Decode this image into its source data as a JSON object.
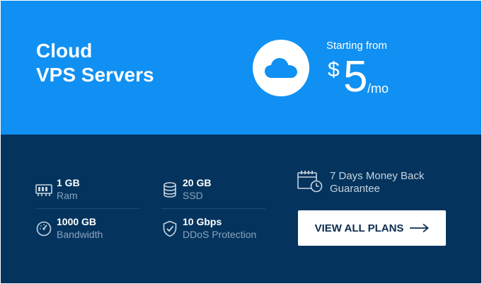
{
  "hero": {
    "title_line1": "Cloud",
    "title_line2": "VPS Servers",
    "starting_label": "Starting from",
    "currency": "$",
    "amount": "5",
    "period": "/mo",
    "icon": "cloud-icon"
  },
  "features": [
    {
      "value": "1 GB",
      "label": "Ram",
      "icon": "ram-chip-icon"
    },
    {
      "value": "20 GB",
      "label": "SSD",
      "icon": "database-icon"
    },
    {
      "value": "1000 GB",
      "label": "Bandwidth",
      "icon": "speedometer-icon"
    },
    {
      "value": "10 Gbps",
      "label": "DDoS Protection",
      "icon": "shield-check-icon"
    }
  ],
  "guarantee": {
    "line1": "7 Days Money Back",
    "line2": "Guarantee",
    "icon": "calendar-clock-icon"
  },
  "cta": {
    "label": "VIEW ALL PLANS",
    "icon": "arrow-right-icon"
  },
  "colors": {
    "hero_bg": "#1090f2",
    "panel_bg": "#04345d",
    "muted_text": "#8aa3bd",
    "button_text": "#0c2d4f"
  }
}
